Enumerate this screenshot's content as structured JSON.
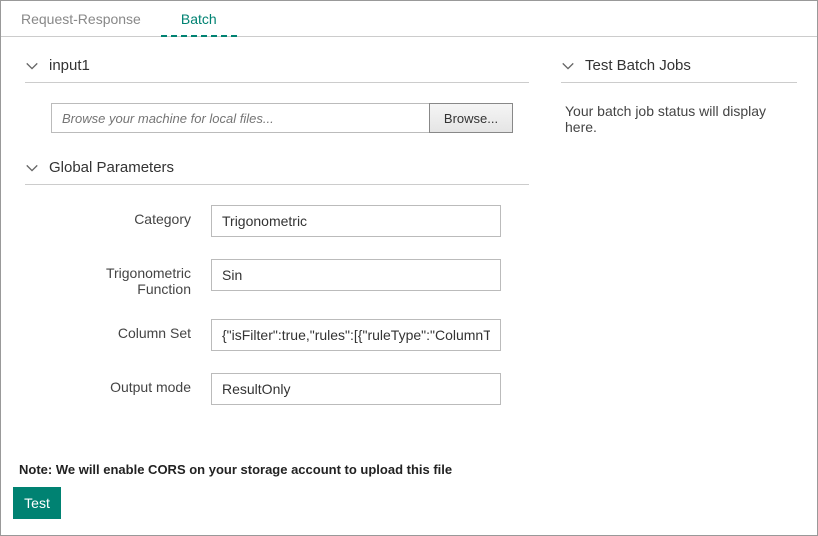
{
  "tabs": {
    "request_response": "Request-Response",
    "batch": "Batch"
  },
  "sections": {
    "input1": "input1",
    "global_params": "Global Parameters",
    "test_batch": "Test Batch Jobs"
  },
  "file": {
    "placeholder": "Browse your machine for local files...",
    "browse_label": "Browse..."
  },
  "params": {
    "category": {
      "label": "Category",
      "value": "Trigonometric"
    },
    "trig_func": {
      "label": "Trigonometric Function",
      "value": "Sin"
    },
    "column_set": {
      "label": "Column Set",
      "value": "{\"isFilter\":true,\"rules\":[{\"ruleType\":\"ColumnTyp"
    },
    "output_mode": {
      "label": "Output mode",
      "value": "ResultOnly"
    }
  },
  "note": "Note: We will enable CORS on your storage account to upload this file",
  "test_button": "Test",
  "batch_status": "Your batch job status will display here."
}
